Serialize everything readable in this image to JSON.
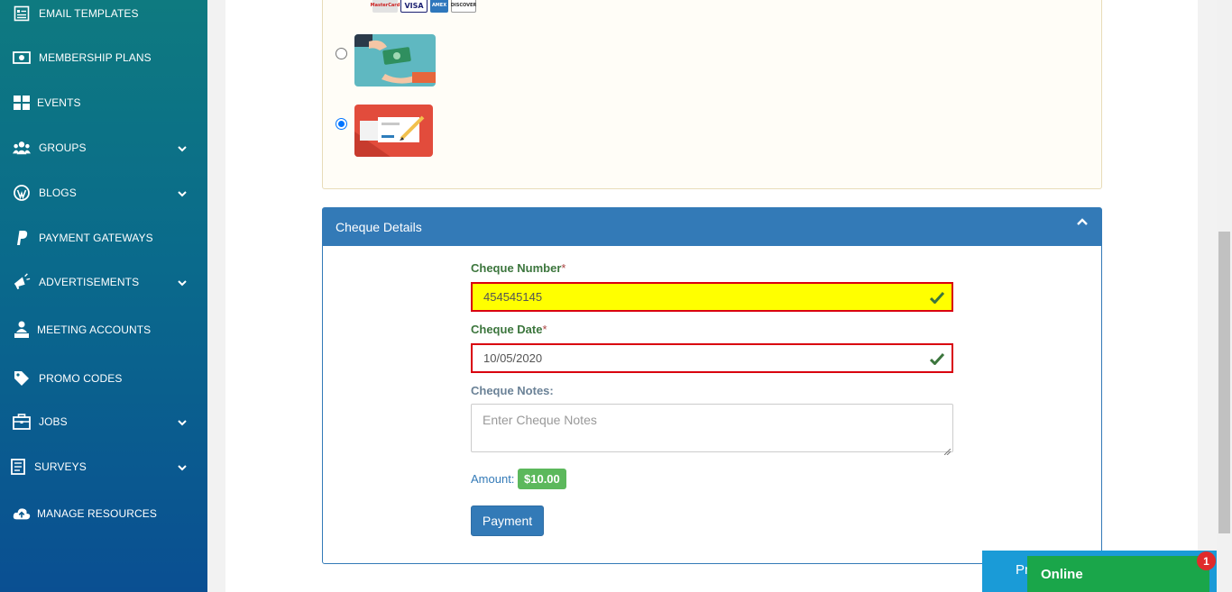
{
  "sidebar": {
    "items": [
      {
        "label": "EMAIL TEMPLATES",
        "icon": "email-template-icon",
        "has_submenu": false
      },
      {
        "label": "MEMBERSHIP PLANS",
        "icon": "money-icon",
        "has_submenu": false
      },
      {
        "label": "EVENTS",
        "icon": "grid-icon",
        "has_submenu": false
      },
      {
        "label": "GROUPS",
        "icon": "users-icon",
        "has_submenu": true
      },
      {
        "label": "BLOGS",
        "icon": "wordpress-icon",
        "has_submenu": true
      },
      {
        "label": "PAYMENT GATEWAYS",
        "icon": "paypal-icon",
        "has_submenu": false
      },
      {
        "label": "ADVERTISEMENTS",
        "icon": "megaphone-icon",
        "has_submenu": true
      },
      {
        "label": "MEETING ACCOUNTS",
        "icon": "user-desk-icon",
        "has_submenu": false
      },
      {
        "label": "PROMO CODES",
        "icon": "tag-icon",
        "has_submenu": false
      },
      {
        "label": "JOBS",
        "icon": "briefcase-icon",
        "has_submenu": true
      },
      {
        "label": "SURVEYS",
        "icon": "survey-icon",
        "has_submenu": true
      },
      {
        "label": "MANAGE RESOURCES",
        "icon": "cloud-upload-icon",
        "has_submenu": false
      }
    ]
  },
  "payment_methods": {
    "card_logos": [
      "MasterCard",
      "VISA",
      "AMEX",
      "DISCOVER"
    ],
    "options": [
      {
        "name": "cash",
        "selected": false
      },
      {
        "name": "cheque",
        "selected": true
      }
    ]
  },
  "cheque": {
    "panel_title": "Cheque Details",
    "number_label": "Cheque Number",
    "number_value": "454545145",
    "date_label": "Cheque Date",
    "date_value": "10/05/2020",
    "notes_label": "Cheque Notes:",
    "notes_placeholder": "Enter Cheque Notes",
    "required_mark": "*",
    "amount_label": "Amount:",
    "amount_value": "$10.00",
    "payment_button": "Payment"
  },
  "chat": {
    "peek_text": "Pr",
    "status": "Online",
    "badge_count": "1"
  },
  "colors": {
    "primary": "#337ab7",
    "success": "#5cb85c",
    "highlight": "#ffff00",
    "error_border": "#d9000f",
    "chat_green": "#1aa64a"
  }
}
